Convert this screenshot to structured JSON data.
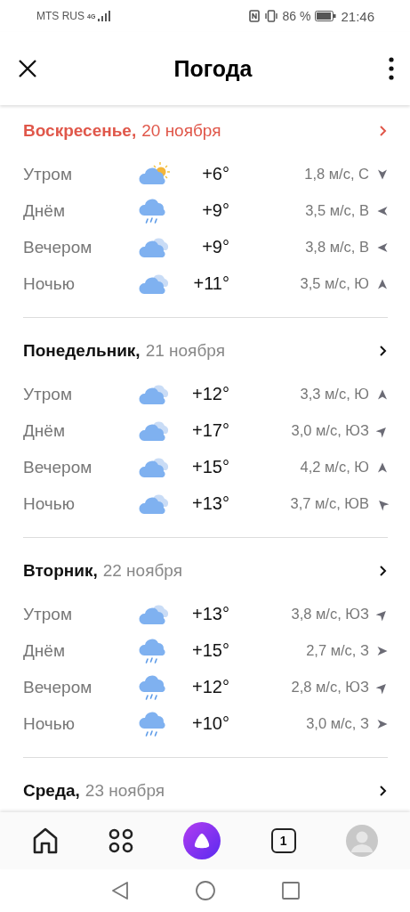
{
  "status_bar": {
    "carrier": "MTS RUS",
    "network": "4G",
    "battery": "86 %",
    "time": "21:46"
  },
  "header": {
    "title": "Погода"
  },
  "days": [
    {
      "weekday": "Воскресенье,",
      "date": "20 ноября",
      "today": true,
      "periods": [
        {
          "name": "Утром",
          "kind": "partly-sunny",
          "temp": "+6°",
          "wind": {
            "text": "1,8 м/с, С",
            "kind": "s"
          }
        },
        {
          "name": "Днём",
          "kind": "rain",
          "temp": "+9°",
          "wind": {
            "text": "3,5 м/с, В",
            "kind": "w"
          }
        },
        {
          "name": "Вечером",
          "kind": "cloudy",
          "temp": "+9°",
          "wind": {
            "text": "3,8 м/с, В",
            "kind": "w"
          }
        },
        {
          "name": "Ночью",
          "kind": "cloudy",
          "temp": "+11°",
          "wind": {
            "text": "3,5 м/с, Ю",
            "kind": "n"
          }
        }
      ]
    },
    {
      "weekday": "Понедельник,",
      "date": "21 ноября",
      "today": false,
      "periods": [
        {
          "name": "Утром",
          "kind": "cloudy",
          "temp": "+12°",
          "wind": {
            "text": "3,3 м/с, Ю",
            "kind": "n"
          }
        },
        {
          "name": "Днём",
          "kind": "cloudy",
          "temp": "+17°",
          "wind": {
            "text": "3,0 м/с, ЮЗ",
            "kind": "ne"
          }
        },
        {
          "name": "Вечером",
          "kind": "cloudy",
          "temp": "+15°",
          "wind": {
            "text": "4,2 м/с, Ю",
            "kind": "n"
          }
        },
        {
          "name": "Ночью",
          "kind": "cloudy",
          "temp": "+13°",
          "wind": {
            "text": "3,7 м/с, ЮВ",
            "kind": "nw"
          }
        }
      ]
    },
    {
      "weekday": "Вторник,",
      "date": "22 ноября",
      "today": false,
      "periods": [
        {
          "name": "Утром",
          "kind": "cloudy",
          "temp": "+13°",
          "wind": {
            "text": "3,8 м/с, ЮЗ",
            "kind": "ne"
          }
        },
        {
          "name": "Днём",
          "kind": "rain",
          "temp": "+15°",
          "wind": {
            "text": "2,7 м/с, З",
            "kind": "e"
          }
        },
        {
          "name": "Вечером",
          "kind": "rain",
          "temp": "+12°",
          "wind": {
            "text": "2,8 м/с, ЮЗ",
            "kind": "ne"
          }
        },
        {
          "name": "Ночью",
          "kind": "rain",
          "temp": "+10°",
          "wind": {
            "text": "3,0 м/с, З",
            "kind": "e"
          }
        }
      ]
    },
    {
      "weekday": "Среда,",
      "date": "23 ноября",
      "today": false
    }
  ],
  "bottom_nav": {
    "tabs_count": "1"
  }
}
